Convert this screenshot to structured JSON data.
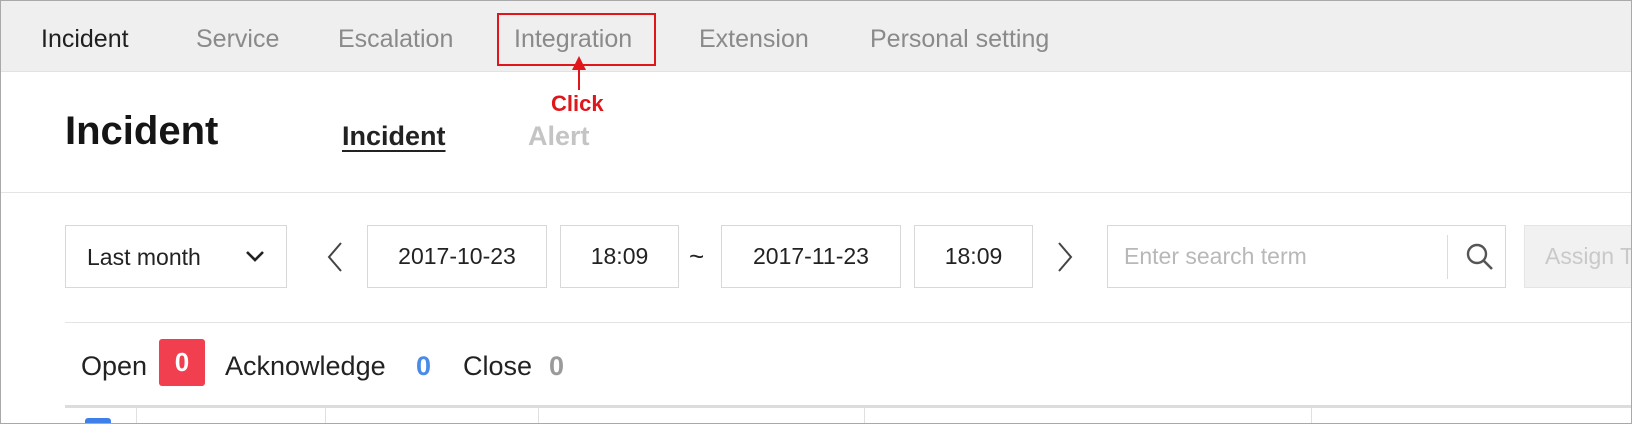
{
  "topnav": {
    "items": [
      {
        "label": "Incident",
        "active": true
      },
      {
        "label": "Service",
        "active": false
      },
      {
        "label": "Escalation",
        "active": false
      },
      {
        "label": "Integration",
        "active": false,
        "highlighted": true
      },
      {
        "label": "Extension",
        "active": false
      },
      {
        "label": "Personal setting",
        "active": false
      }
    ]
  },
  "annotation": {
    "text": "Click",
    "color": "#e0161b"
  },
  "page": {
    "title": "Incident",
    "subtabs": [
      {
        "label": "Incident",
        "active": true
      },
      {
        "label": "Alert",
        "active": false
      }
    ]
  },
  "filters": {
    "period": {
      "value": "Last month",
      "icon": "chevron-down-icon"
    },
    "prev_icon": "chevron-left-icon",
    "start_date": "2017-10-23",
    "start_time": "18:09",
    "separator": "~",
    "end_date": "2017-11-23",
    "end_time": "18:09",
    "next_icon": "chevron-right-icon",
    "search": {
      "placeholder": "Enter search term",
      "value": "",
      "icon": "search-icon"
    },
    "assign_label": "Assign T"
  },
  "summary": {
    "open": {
      "label": "Open",
      "count": "0",
      "color": "#f23f4f"
    },
    "acknowledge": {
      "label": "Acknowledge",
      "count": "0",
      "color": "#4a8be8"
    },
    "close": {
      "label": "Close",
      "count": "0",
      "color": "#9a9a9a"
    }
  },
  "colors": {
    "accent_blue": "#3f7fe8",
    "annotation_red": "#e0161b",
    "nav_bg": "#efefef"
  }
}
